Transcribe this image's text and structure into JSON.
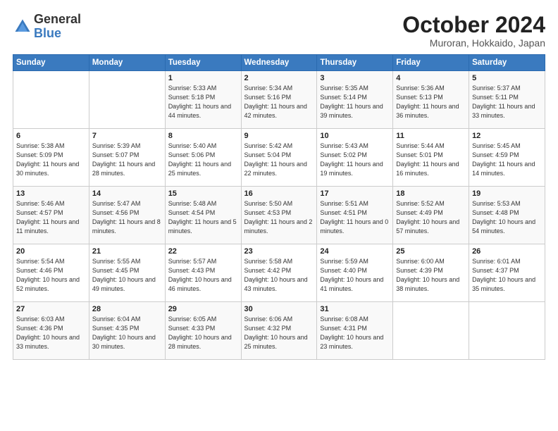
{
  "header": {
    "logo_general": "General",
    "logo_blue": "Blue",
    "month_title": "October 2024",
    "location": "Muroran, Hokkaido, Japan"
  },
  "weekdays": [
    "Sunday",
    "Monday",
    "Tuesday",
    "Wednesday",
    "Thursday",
    "Friday",
    "Saturday"
  ],
  "weeks": [
    [
      {
        "day": "",
        "info": ""
      },
      {
        "day": "",
        "info": ""
      },
      {
        "day": "1",
        "info": "Sunrise: 5:33 AM\nSunset: 5:18 PM\nDaylight: 11 hours and 44 minutes."
      },
      {
        "day": "2",
        "info": "Sunrise: 5:34 AM\nSunset: 5:16 PM\nDaylight: 11 hours and 42 minutes."
      },
      {
        "day": "3",
        "info": "Sunrise: 5:35 AM\nSunset: 5:14 PM\nDaylight: 11 hours and 39 minutes."
      },
      {
        "day": "4",
        "info": "Sunrise: 5:36 AM\nSunset: 5:13 PM\nDaylight: 11 hours and 36 minutes."
      },
      {
        "day": "5",
        "info": "Sunrise: 5:37 AM\nSunset: 5:11 PM\nDaylight: 11 hours and 33 minutes."
      }
    ],
    [
      {
        "day": "6",
        "info": "Sunrise: 5:38 AM\nSunset: 5:09 PM\nDaylight: 11 hours and 30 minutes."
      },
      {
        "day": "7",
        "info": "Sunrise: 5:39 AM\nSunset: 5:07 PM\nDaylight: 11 hours and 28 minutes."
      },
      {
        "day": "8",
        "info": "Sunrise: 5:40 AM\nSunset: 5:06 PM\nDaylight: 11 hours and 25 minutes."
      },
      {
        "day": "9",
        "info": "Sunrise: 5:42 AM\nSunset: 5:04 PM\nDaylight: 11 hours and 22 minutes."
      },
      {
        "day": "10",
        "info": "Sunrise: 5:43 AM\nSunset: 5:02 PM\nDaylight: 11 hours and 19 minutes."
      },
      {
        "day": "11",
        "info": "Sunrise: 5:44 AM\nSunset: 5:01 PM\nDaylight: 11 hours and 16 minutes."
      },
      {
        "day": "12",
        "info": "Sunrise: 5:45 AM\nSunset: 4:59 PM\nDaylight: 11 hours and 14 minutes."
      }
    ],
    [
      {
        "day": "13",
        "info": "Sunrise: 5:46 AM\nSunset: 4:57 PM\nDaylight: 11 hours and 11 minutes."
      },
      {
        "day": "14",
        "info": "Sunrise: 5:47 AM\nSunset: 4:56 PM\nDaylight: 11 hours and 8 minutes."
      },
      {
        "day": "15",
        "info": "Sunrise: 5:48 AM\nSunset: 4:54 PM\nDaylight: 11 hours and 5 minutes."
      },
      {
        "day": "16",
        "info": "Sunrise: 5:50 AM\nSunset: 4:53 PM\nDaylight: 11 hours and 2 minutes."
      },
      {
        "day": "17",
        "info": "Sunrise: 5:51 AM\nSunset: 4:51 PM\nDaylight: 11 hours and 0 minutes."
      },
      {
        "day": "18",
        "info": "Sunrise: 5:52 AM\nSunset: 4:49 PM\nDaylight: 10 hours and 57 minutes."
      },
      {
        "day": "19",
        "info": "Sunrise: 5:53 AM\nSunset: 4:48 PM\nDaylight: 10 hours and 54 minutes."
      }
    ],
    [
      {
        "day": "20",
        "info": "Sunrise: 5:54 AM\nSunset: 4:46 PM\nDaylight: 10 hours and 52 minutes."
      },
      {
        "day": "21",
        "info": "Sunrise: 5:55 AM\nSunset: 4:45 PM\nDaylight: 10 hours and 49 minutes."
      },
      {
        "day": "22",
        "info": "Sunrise: 5:57 AM\nSunset: 4:43 PM\nDaylight: 10 hours and 46 minutes."
      },
      {
        "day": "23",
        "info": "Sunrise: 5:58 AM\nSunset: 4:42 PM\nDaylight: 10 hours and 43 minutes."
      },
      {
        "day": "24",
        "info": "Sunrise: 5:59 AM\nSunset: 4:40 PM\nDaylight: 10 hours and 41 minutes."
      },
      {
        "day": "25",
        "info": "Sunrise: 6:00 AM\nSunset: 4:39 PM\nDaylight: 10 hours and 38 minutes."
      },
      {
        "day": "26",
        "info": "Sunrise: 6:01 AM\nSunset: 4:37 PM\nDaylight: 10 hours and 35 minutes."
      }
    ],
    [
      {
        "day": "27",
        "info": "Sunrise: 6:03 AM\nSunset: 4:36 PM\nDaylight: 10 hours and 33 minutes."
      },
      {
        "day": "28",
        "info": "Sunrise: 6:04 AM\nSunset: 4:35 PM\nDaylight: 10 hours and 30 minutes."
      },
      {
        "day": "29",
        "info": "Sunrise: 6:05 AM\nSunset: 4:33 PM\nDaylight: 10 hours and 28 minutes."
      },
      {
        "day": "30",
        "info": "Sunrise: 6:06 AM\nSunset: 4:32 PM\nDaylight: 10 hours and 25 minutes."
      },
      {
        "day": "31",
        "info": "Sunrise: 6:08 AM\nSunset: 4:31 PM\nDaylight: 10 hours and 23 minutes."
      },
      {
        "day": "",
        "info": ""
      },
      {
        "day": "",
        "info": ""
      }
    ]
  ]
}
